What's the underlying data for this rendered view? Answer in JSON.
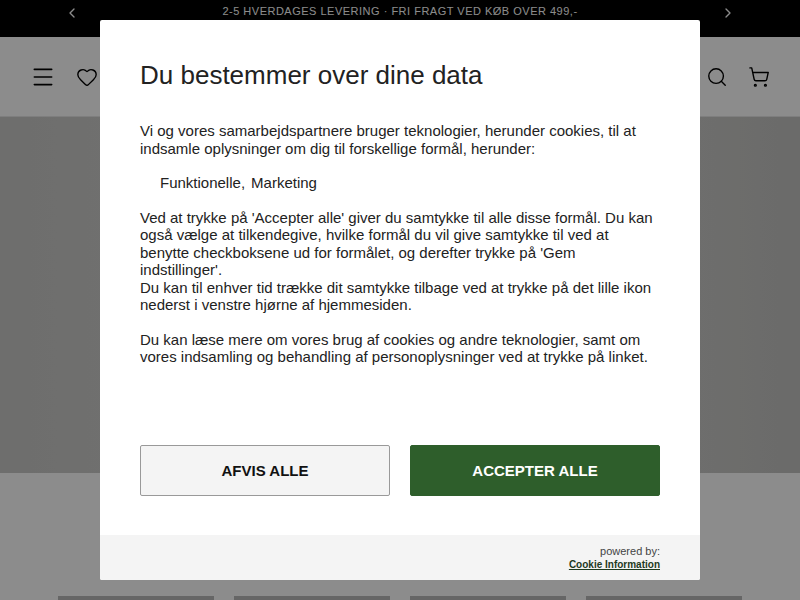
{
  "announcement": {
    "text": "2-5 HVERDAGES LEVERING · FRI FRAGT VED KØB OVER 499,-"
  },
  "dialog": {
    "title": "Du bestemmer over dine data",
    "intro": "Vi og vores samarbejdspartnere bruger teknologier, herunder cookies, til at indsamle oplysninger om dig til forskellige formål, herunder:",
    "purposes": [
      "Funktionelle,",
      "Marketing"
    ],
    "paragraphs": [
      "Ved at trykke på 'Accepter alle' giver du samtykke til alle disse formål. Du kan også vælge at tilkendegive, hvilke formål du vil give samtykke til ved at benytte checkboksene ud for formålet, og derefter trykke på 'Gem indstillinger'.",
      "Du kan til enhver tid trække dit samtykke tilbage ved at trykke på det lille ikon nederst i venstre hjørne af hjemmesiden."
    ],
    "more": "Du kan læse mere om vores brug af cookies og andre teknologier, samt om vores indsamling og behandling af personoplysninger ved at trykke på linket.",
    "buttons": [
      {
        "label": "AFVIS ALLE",
        "kind": "secondary"
      },
      {
        "label": "ACCEPTER ALLE",
        "kind": "primary"
      }
    ],
    "footer": {
      "powered": "powered by:",
      "link": "Cookie Information"
    }
  }
}
